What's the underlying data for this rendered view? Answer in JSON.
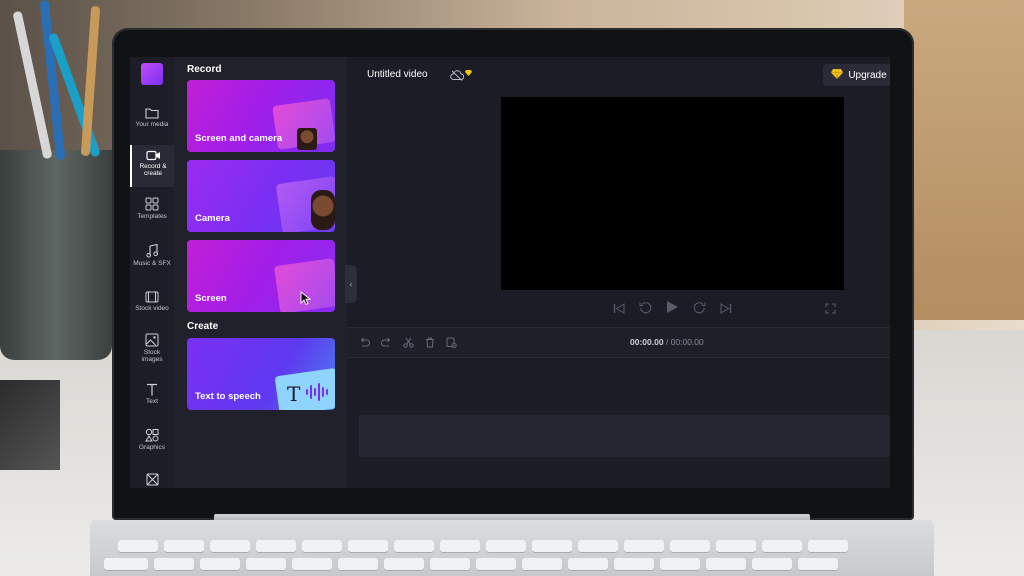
{
  "app": {
    "project_title": "Untitled video",
    "upgrade_label": "Upgrade"
  },
  "nav": {
    "items": [
      {
        "label": "Your media",
        "icon": "folder-icon"
      },
      {
        "label": "Record &\ncreate",
        "icon": "video-camera-icon",
        "active": true
      },
      {
        "label": "Templates",
        "icon": "templates-icon"
      },
      {
        "label": "Music & SFX",
        "icon": "music-note-icon"
      },
      {
        "label": "Stock video",
        "icon": "film-icon"
      },
      {
        "label": "Stock\nimages",
        "icon": "image-icon"
      },
      {
        "label": "Text",
        "icon": "text-icon"
      },
      {
        "label": "Graphics",
        "icon": "shapes-icon"
      }
    ]
  },
  "panel": {
    "record_heading": "Record",
    "create_heading": "Create",
    "cards": [
      {
        "label": "Screen and camera"
      },
      {
        "label": "Camera"
      },
      {
        "label": "Screen"
      },
      {
        "label": "Text to speech"
      }
    ]
  },
  "timeline": {
    "current_time": "00:00.00",
    "separator": " / ",
    "total_time": "00:00.00"
  },
  "colors": {
    "accent_purple": "#8b2cf5",
    "accent_magenta": "#c21fd6",
    "app_background": "#1c1c26",
    "premium_gold": "#f5c518"
  }
}
